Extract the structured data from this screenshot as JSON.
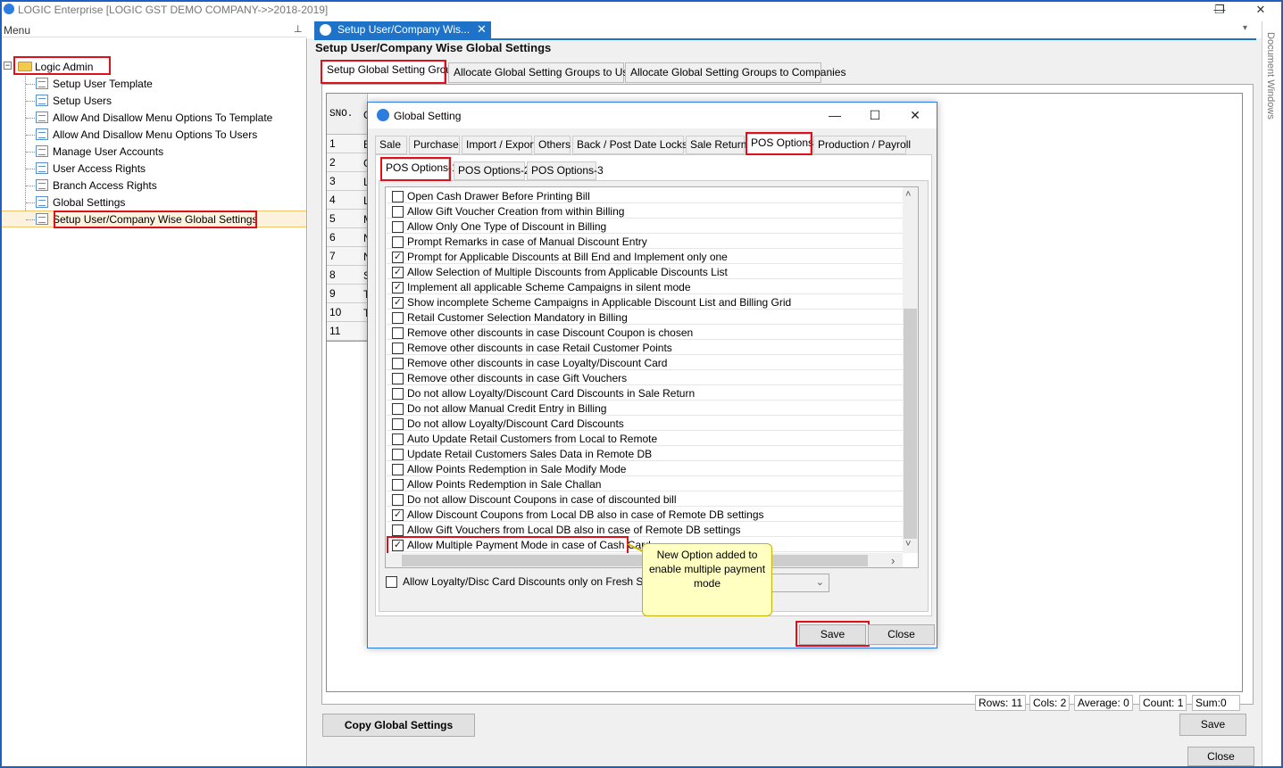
{
  "window": {
    "title": "LOGIC Enterprise   [LOGIC GST DEMO COMPANY->>2018-2019]",
    "minimize": "—",
    "restore": "❐",
    "close": "✕"
  },
  "menu": {
    "title": "Menu",
    "pin": "📌",
    "root": "Logic Admin",
    "expander": "−",
    "items": [
      {
        "label": "Setup User Template"
      },
      {
        "label": "Setup Users"
      },
      {
        "label": "Allow And Disallow Menu Options To Template"
      },
      {
        "label": "Allow And Disallow Menu Options To Users"
      },
      {
        "label": "Manage User Accounts"
      },
      {
        "label": "User Access Rights"
      },
      {
        "label": "Branch Access Rights"
      },
      {
        "label": "Global Settings"
      },
      {
        "label": "Setup User/Company Wise Global Settings"
      }
    ]
  },
  "document": {
    "tab_label": "Setup User/Company Wis...",
    "tab_close": "✕",
    "heading": "Setup User/Company Wise Global Settings",
    "chevron": "▾",
    "rail": "Document Windows",
    "tabs": [
      {
        "label": "Setup Global Setting Groups"
      },
      {
        "label": "Allocate Global Setting Groups to Users"
      },
      {
        "label": "Allocate Global Setting Groups to Companies"
      }
    ],
    "grid": {
      "header": "SNO.",
      "col2_header": "G",
      "rows": [
        {
          "sno": "1",
          "c": "B"
        },
        {
          "sno": "2",
          "c": "G"
        },
        {
          "sno": "3",
          "c": "L"
        },
        {
          "sno": "4",
          "c": "L"
        },
        {
          "sno": "5",
          "c": "M"
        },
        {
          "sno": "6",
          "c": "N"
        },
        {
          "sno": "7",
          "c": "N"
        },
        {
          "sno": "8",
          "c": "S"
        },
        {
          "sno": "9",
          "c": "T"
        },
        {
          "sno": "10",
          "c": "T"
        },
        {
          "sno": "11",
          "c": ""
        }
      ]
    },
    "status": {
      "rows": "Rows: 11",
      "cols": "Cols: 2",
      "average": "Average: 0",
      "count": "Count: 1",
      "sum": "Sum:0"
    },
    "copy_button": "Copy Global Settings",
    "save_button": "Save",
    "close_button": "Close"
  },
  "dialog": {
    "title": "Global Setting",
    "minimize": "—",
    "maximize": "☐",
    "close": "✕",
    "tabs": [
      {
        "label": "Sale"
      },
      {
        "label": "Purchase"
      },
      {
        "label": "Import / Export"
      },
      {
        "label": "Others"
      },
      {
        "label": "Back / Post Date Locks"
      },
      {
        "label": "Sale Return"
      },
      {
        "label": "POS Options"
      },
      {
        "label": "Production  / Payroll"
      }
    ],
    "subtabs": [
      {
        "label": "POS Options-1"
      },
      {
        "label": "POS Options-2"
      },
      {
        "label": "POS Options-3"
      }
    ],
    "options": [
      {
        "label": "Open Cash Drawer Before Printing Bill",
        "mark": ""
      },
      {
        "label": "Allow Gift Voucher Creation from within Billing",
        "mark": ""
      },
      {
        "label": "Allow Only One Type of Discount in Billing",
        "mark": ""
      },
      {
        "label": "Prompt Remarks in case of Manual Discount Entry",
        "mark": ""
      },
      {
        "label": "Prompt for Applicable Discounts at Bill End and Implement only one",
        "mark": "✓"
      },
      {
        "label": "Allow Selection of Multiple Discounts from Applicable Discounts List",
        "mark": "✓"
      },
      {
        "label": "Implement all applicable Scheme Campaigns in silent mode",
        "mark": "✓"
      },
      {
        "label": "Show incomplete Scheme Campaigns in Applicable Discount List and Billing Grid",
        "mark": "✓"
      },
      {
        "label": "Retail Customer Selection Mandatory in Billing",
        "mark": ""
      },
      {
        "label": "Remove other discounts in case Discount Coupon is chosen",
        "mark": ""
      },
      {
        "label": "Remove other discounts in case Retail Customer Points",
        "mark": ""
      },
      {
        "label": "Remove other discounts in case Loyalty/Discount Card",
        "mark": ""
      },
      {
        "label": "Remove other discounts in case Gift Vouchers",
        "mark": ""
      },
      {
        "label": "Do not allow Loyalty/Discount Card Discounts in Sale Return",
        "mark": ""
      },
      {
        "label": "Do not allow Manual Credit Entry in Billing",
        "mark": ""
      },
      {
        "label": "Do not allow Loyalty/Discount Card Discounts",
        "mark": ""
      },
      {
        "label": "Auto Update Retail Customers from Local to Remote",
        "mark": ""
      },
      {
        "label": "Update Retail Customers Sales Data in Remote DB",
        "mark": ""
      },
      {
        "label": "Allow Points Redemption in Sale Modify Mode",
        "mark": ""
      },
      {
        "label": "Allow Points Redemption in Sale Challan",
        "mark": ""
      },
      {
        "label": "Do not allow Discount Coupons in case of discounted bill",
        "mark": ""
      },
      {
        "label": "Allow Discount Coupons from Local DB also in case of Remote DB settings",
        "mark": "✓"
      },
      {
        "label": "Allow Gift Vouchers from Local DB also in case of Remote DB settings",
        "mark": ""
      },
      {
        "label": "Allow Multiple Payment Mode in case of Cash Card",
        "mark": "✓"
      }
    ],
    "scroll_up": "˄",
    "scroll_down": "˅",
    "scroll_right": "›",
    "bottom_option": "Allow Loyalty/Disc Card Discounts only on Fresh Stock i.e.",
    "combo_arrow": "⌄",
    "callout": "New Option added to enable multiple payment mode",
    "save_button": "Save",
    "close_button": "Close"
  }
}
